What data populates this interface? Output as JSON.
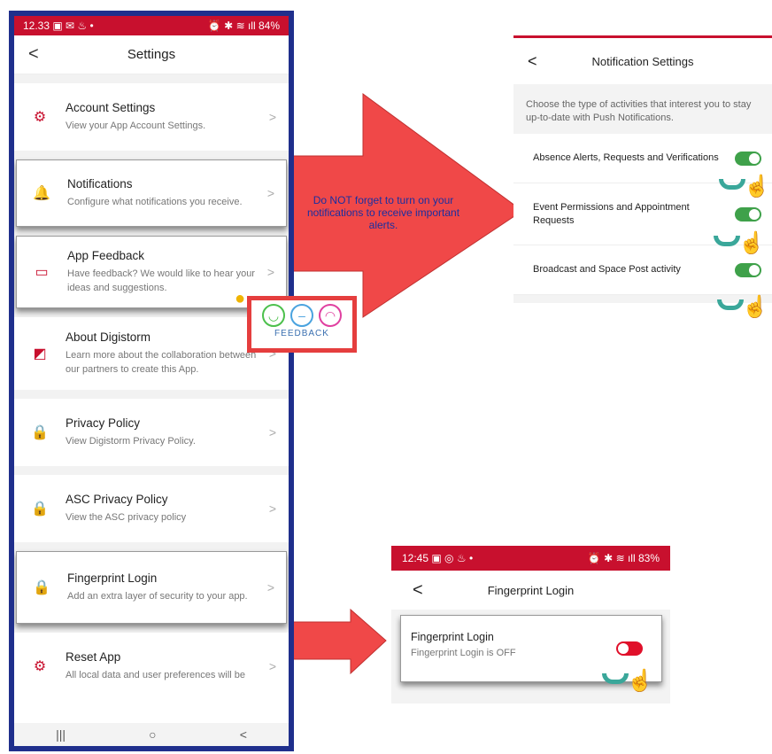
{
  "settings_phone": {
    "status": {
      "time": "12.33",
      "left_icons": "▣ ✉ ♨ •",
      "right_icons": "⏰ ✱ ≋ ıll",
      "battery": "84%"
    },
    "header": {
      "back": "<",
      "title": "Settings"
    },
    "items": [
      {
        "title": "Account Settings",
        "subtitle": "View your App Account Settings.",
        "icon": "⚙"
      },
      {
        "title": "Notifications",
        "subtitle": "Configure what notifications you receive.",
        "icon": "🔔"
      },
      {
        "title": "App Feedback",
        "subtitle": "Have feedback? We would like to hear your ideas and suggestions.",
        "icon": "▭"
      },
      {
        "title": "About Digistorm",
        "subtitle": "Learn more about the collaboration between our partners to create this App.",
        "icon": "◩"
      },
      {
        "title": "Privacy Policy",
        "subtitle": "View Digistorm Privacy Policy.",
        "icon": "🔒"
      },
      {
        "title": "ASC Privacy Policy",
        "subtitle": "View the ASC privacy policy",
        "icon": "🔒"
      },
      {
        "title": "Fingerprint Login",
        "subtitle": "Add an extra layer of security to your app.",
        "icon": "🔒"
      },
      {
        "title": "Reset App",
        "subtitle": "All local data and user preferences will be",
        "icon": "⚙"
      }
    ],
    "chevron": ">",
    "nav": [
      "|||",
      "○",
      "<"
    ]
  },
  "callout_text": "Do NOT forget to turn on your notifications to receive important alerts.",
  "feedback_label": "FEEDBACK",
  "notification_settings": {
    "title": "Notification Settings",
    "back": "<",
    "description": "Choose the type of activities that interest you to stay up-to-date with Push Notifications.",
    "rows": [
      {
        "label": "Absence Alerts, Requests and Verifications",
        "enabled": true
      },
      {
        "label": "Event Permissions and Appointment Requests",
        "enabled": true
      },
      {
        "label": "Broadcast and Space Post activity",
        "enabled": true
      }
    ]
  },
  "fingerprint_phone": {
    "status": {
      "time": "12:45",
      "left_icons": "▣ ◎ ♨ •",
      "right_icons": "⏰ ✱ ≋ ıll",
      "battery": "83%"
    },
    "back": "<",
    "title": "Fingerprint Login",
    "card_title": "Fingerprint Login",
    "card_subtitle": "Fingerprint Login is OFF",
    "enabled": false
  },
  "colors": {
    "brand_red": "#c8102e",
    "toggle_on": "#3fa14a",
    "toggle_off": "#e0102a",
    "arrow_red": "#f04848"
  }
}
